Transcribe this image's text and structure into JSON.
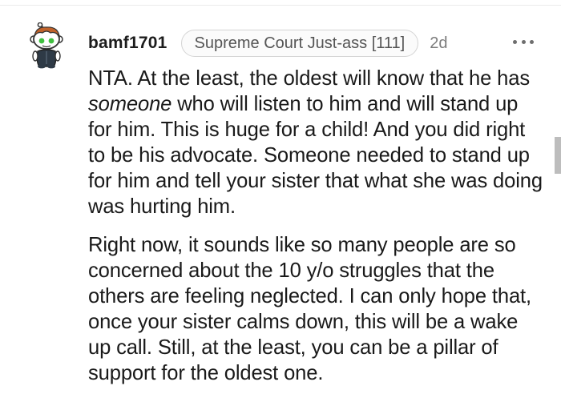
{
  "comment": {
    "username": "bamf1701",
    "flair": "Supreme Court Just-ass [111]",
    "timestamp": "2d",
    "body": {
      "p1_pre": "NTA. At the least, the oldest will know that he has ",
      "p1_em": "someone",
      "p1_post": " who will listen to him and will stand up for him. This is huge for a child! And you did right to be his advocate. Someone needed to stand up for him and tell your sister that what she was doing was hurting him.",
      "p2": "Right now, it sounds like so many people are so concerned about the 10 y/o struggles that the others are feeling neglected. I can only hope that, once your sister calms down, this will be a wake up call. Still, at the least, you can be a pillar of support for the oldest one."
    }
  },
  "icons": {
    "avatar": "reddit-snoo-avatar-icon",
    "more": "more-options-icon"
  },
  "colors": {
    "avatar_hair": "#c0622a",
    "avatar_eyes": "#3fbf3f",
    "text": "#1a1a1a",
    "meta": "#7c7c7c"
  }
}
